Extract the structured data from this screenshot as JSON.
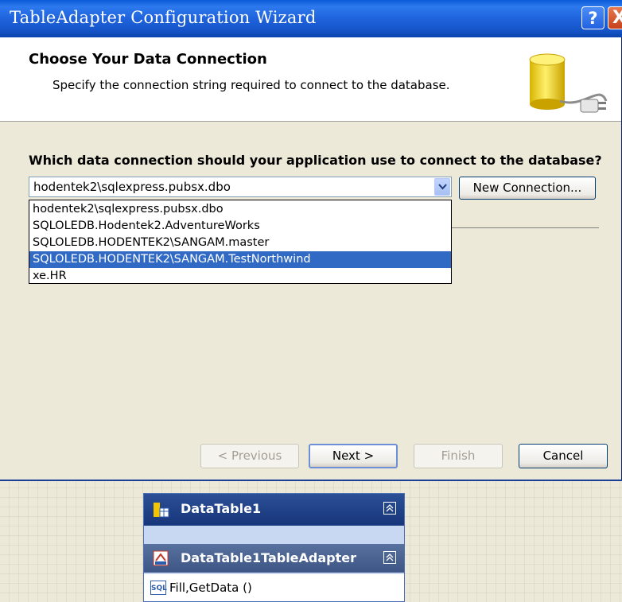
{
  "window": {
    "title": "TableAdapter Configuration Wizard",
    "help_label": "?",
    "close_label": "X"
  },
  "header": {
    "title": "Choose Your Data Connection",
    "subtitle": "Specify the connection string required to connect to the database.",
    "icon": "database-plug-icon"
  },
  "body": {
    "question": "Which data connection should your application use to connect to the database?",
    "combo_value": "hodentek2\\sqlexpress.pubsx.dbo",
    "new_connection_label": "New Connection...",
    "dropdown_items": [
      "hodentek2\\sqlexpress.pubsx.dbo",
      "SQLOLEDB.Hodentek2.AdventureWorks",
      "SQLOLEDB.HODENTEK2\\SANGAM.master",
      "SQLOLEDB.HODENTEK2\\SANGAM.TestNorthwind",
      "xe.HR"
    ],
    "selected_index": 3
  },
  "buttons": {
    "previous": "< Previous",
    "next": "Next >",
    "finish": "Finish",
    "cancel": "Cancel"
  },
  "designer": {
    "table_name": "DataTable1",
    "adapter_name": "DataTable1TableAdapter",
    "method": "Fill,GetData ()",
    "sql_icon_label": "SQL"
  },
  "colors": {
    "titlebar": "#1f63dc",
    "selection": "#316ac5",
    "dialog_bg": "#ece9d8"
  }
}
